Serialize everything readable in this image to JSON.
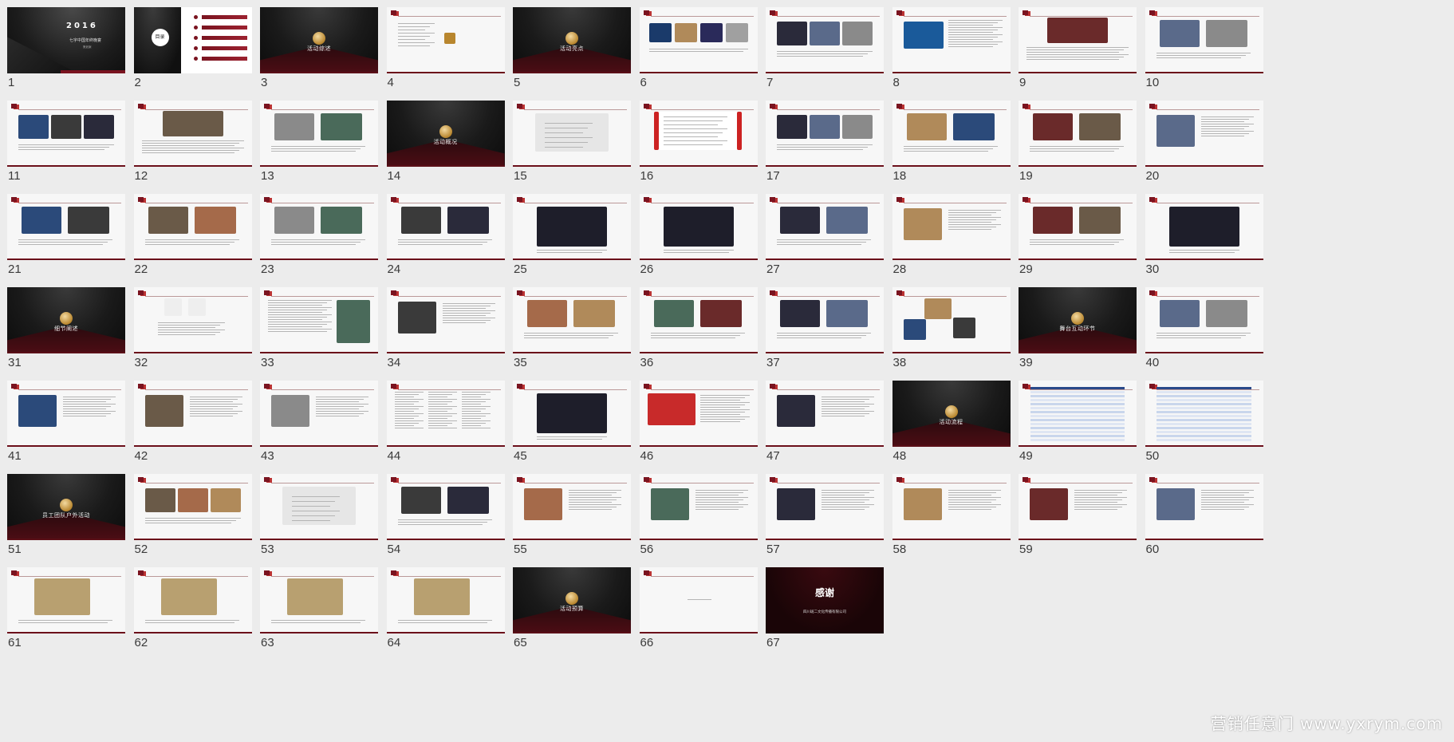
{
  "app": {
    "view": "slide-sorter"
  },
  "slides": [
    {
      "n": "1",
      "kind": "cover",
      "year": "2016",
      "title": "七字中国年终晚宴",
      "tag": "策划案"
    },
    {
      "n": "2",
      "kind": "agenda",
      "title": "目录"
    },
    {
      "n": "3",
      "kind": "dark",
      "title": "活动综述"
    },
    {
      "n": "4",
      "kind": "content",
      "variant": "brand"
    },
    {
      "n": "5",
      "kind": "dark",
      "title": "活动亮点"
    },
    {
      "n": "6",
      "kind": "content",
      "variant": "photos4"
    },
    {
      "n": "7",
      "kind": "content",
      "variant": "photos3"
    },
    {
      "n": "8",
      "kind": "content",
      "variant": "blue-text"
    },
    {
      "n": "9",
      "kind": "content",
      "variant": "wide-photo"
    },
    {
      "n": "10",
      "kind": "content",
      "variant": "photos2"
    },
    {
      "n": "11",
      "kind": "content",
      "variant": "photos3"
    },
    {
      "n": "12",
      "kind": "content",
      "variant": "wide-photo"
    },
    {
      "n": "13",
      "kind": "content",
      "variant": "photos2"
    },
    {
      "n": "14",
      "kind": "dark",
      "title": "活动概况"
    },
    {
      "n": "15",
      "kind": "content",
      "variant": "map"
    },
    {
      "n": "16",
      "kind": "content",
      "variant": "layout"
    },
    {
      "n": "17",
      "kind": "content",
      "variant": "photos3"
    },
    {
      "n": "18",
      "kind": "content",
      "variant": "photos2"
    },
    {
      "n": "19",
      "kind": "content",
      "variant": "photos2"
    },
    {
      "n": "20",
      "kind": "content",
      "variant": "photo-text"
    },
    {
      "n": "21",
      "kind": "content",
      "variant": "photos2"
    },
    {
      "n": "22",
      "kind": "content",
      "variant": "photos2"
    },
    {
      "n": "23",
      "kind": "content",
      "variant": "photos2"
    },
    {
      "n": "24",
      "kind": "content",
      "variant": "photos2"
    },
    {
      "n": "25",
      "kind": "content",
      "variant": "single-photo"
    },
    {
      "n": "26",
      "kind": "content",
      "variant": "single-photo"
    },
    {
      "n": "27",
      "kind": "content",
      "variant": "photos2"
    },
    {
      "n": "28",
      "kind": "content",
      "variant": "photo-text"
    },
    {
      "n": "29",
      "kind": "content",
      "variant": "photos2"
    },
    {
      "n": "30",
      "kind": "content",
      "variant": "single-photo"
    },
    {
      "n": "31",
      "kind": "dark",
      "title": "细节阐述"
    },
    {
      "n": "32",
      "kind": "content",
      "variant": "pandas"
    },
    {
      "n": "33",
      "kind": "content",
      "variant": "text-photo"
    },
    {
      "n": "34",
      "kind": "content",
      "variant": "photo-text"
    },
    {
      "n": "35",
      "kind": "content",
      "variant": "photos2"
    },
    {
      "n": "36",
      "kind": "content",
      "variant": "photos2"
    },
    {
      "n": "37",
      "kind": "content",
      "variant": "photos2"
    },
    {
      "n": "38",
      "kind": "content",
      "variant": "collage"
    },
    {
      "n": "39",
      "kind": "dark",
      "title": "舞台互动环节"
    },
    {
      "n": "40",
      "kind": "content",
      "variant": "photos2"
    },
    {
      "n": "41",
      "kind": "content",
      "variant": "photo-text"
    },
    {
      "n": "42",
      "kind": "content",
      "variant": "photo-text"
    },
    {
      "n": "43",
      "kind": "content",
      "variant": "photo-text"
    },
    {
      "n": "44",
      "kind": "content",
      "variant": "text-cols"
    },
    {
      "n": "45",
      "kind": "content",
      "variant": "single-photo"
    },
    {
      "n": "46",
      "kind": "content",
      "variant": "red-graphic"
    },
    {
      "n": "47",
      "kind": "content",
      "variant": "photo-text"
    },
    {
      "n": "48",
      "kind": "dark",
      "title": "活动流程"
    },
    {
      "n": "49",
      "kind": "content",
      "variant": "table"
    },
    {
      "n": "50",
      "kind": "content",
      "variant": "table"
    },
    {
      "n": "51",
      "kind": "dark",
      "title": "员工团队户外活动"
    },
    {
      "n": "52",
      "kind": "content",
      "variant": "photos3"
    },
    {
      "n": "53",
      "kind": "content",
      "variant": "map"
    },
    {
      "n": "54",
      "kind": "content",
      "variant": "photos2"
    },
    {
      "n": "55",
      "kind": "content",
      "variant": "photo-text"
    },
    {
      "n": "56",
      "kind": "content",
      "variant": "photo-text"
    },
    {
      "n": "57",
      "kind": "content",
      "variant": "photo-text"
    },
    {
      "n": "58",
      "kind": "content",
      "variant": "photo-text"
    },
    {
      "n": "59",
      "kind": "content",
      "variant": "photo-text"
    },
    {
      "n": "60",
      "kind": "content",
      "variant": "photo-text"
    },
    {
      "n": "61",
      "kind": "content",
      "variant": "food"
    },
    {
      "n": "62",
      "kind": "content",
      "variant": "food"
    },
    {
      "n": "63",
      "kind": "content",
      "variant": "food"
    },
    {
      "n": "64",
      "kind": "content",
      "variant": "food"
    },
    {
      "n": "65",
      "kind": "dark",
      "title": "活动预算"
    },
    {
      "n": "66",
      "kind": "content",
      "variant": "blank"
    },
    {
      "n": "67",
      "kind": "thanks",
      "title": "感谢",
      "tag": "四川斑二文化传播有限公司"
    }
  ],
  "watermark": "营销任意门 www.yxrym.com",
  "colors": {
    "accent": "#7a1420",
    "background": "#ececec"
  }
}
